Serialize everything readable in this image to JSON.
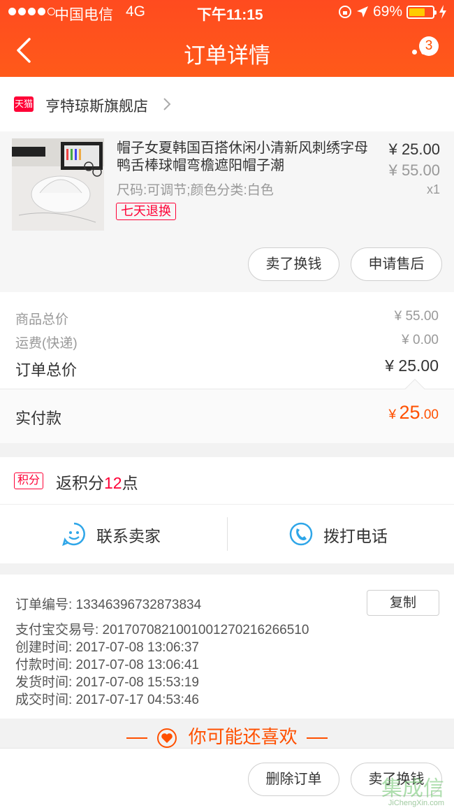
{
  "status_bar": {
    "carrier": "中国电信",
    "network": "4G",
    "time": "下午11:15",
    "battery": "69%"
  },
  "nav": {
    "title": "订单详情",
    "badge_count": "3"
  },
  "shop": {
    "platform_badge": "天猫",
    "name": "亨特琼斯旗舰店"
  },
  "product": {
    "title": "帽子女夏韩国百搭休闲小清新风刺绣字母鸭舌棒球帽弯檐遮阳帽子潮",
    "sku": "尺码:可调节;颜色分类:白色",
    "tag": "七天退换",
    "price": "¥ 25.00",
    "original_price": "¥ 55.00",
    "quantity": "x1",
    "buttons": {
      "sell": "卖了换钱",
      "after_sale": "申请售后"
    }
  },
  "summary": {
    "goods_label": "商品总价",
    "goods_value": "¥ 55.00",
    "shipping_label": "运费(快递)",
    "shipping_value": "¥ 0.00",
    "total_label": "订单总价",
    "total_value": "¥ 25.00"
  },
  "paid": {
    "label": "实付款",
    "currency": "¥",
    "integer": "25",
    "decimal": ".00"
  },
  "points": {
    "tag": "积分",
    "prefix": "返积分",
    "number": "12",
    "suffix": "点"
  },
  "contact": {
    "seller": "联系卖家",
    "phone": "拨打电话"
  },
  "order_info": {
    "order_no": "订单编号:  13346396732873834",
    "copy": "复制",
    "alipay_no": "支付宝交易号:  2017070821001001270216266510",
    "created": "创建时间:  2017-07-08 13:06:37",
    "paid": "付款时间:  2017-07-08 13:06:41",
    "shipped": "发货时间:  2017-07-08 15:53:19",
    "completed": "成交时间:  2017-07-17 04:53:46"
  },
  "recommend": {
    "title": "你可能还喜欢"
  },
  "bottom_bar": {
    "delete": "删除订单",
    "sell": "卖了换钱"
  },
  "watermark": {
    "main": "集成信",
    "sub": "JiChengXin.com"
  },
  "colors": {
    "brand": "#ff5000",
    "tmall_red": "#ff0036"
  }
}
